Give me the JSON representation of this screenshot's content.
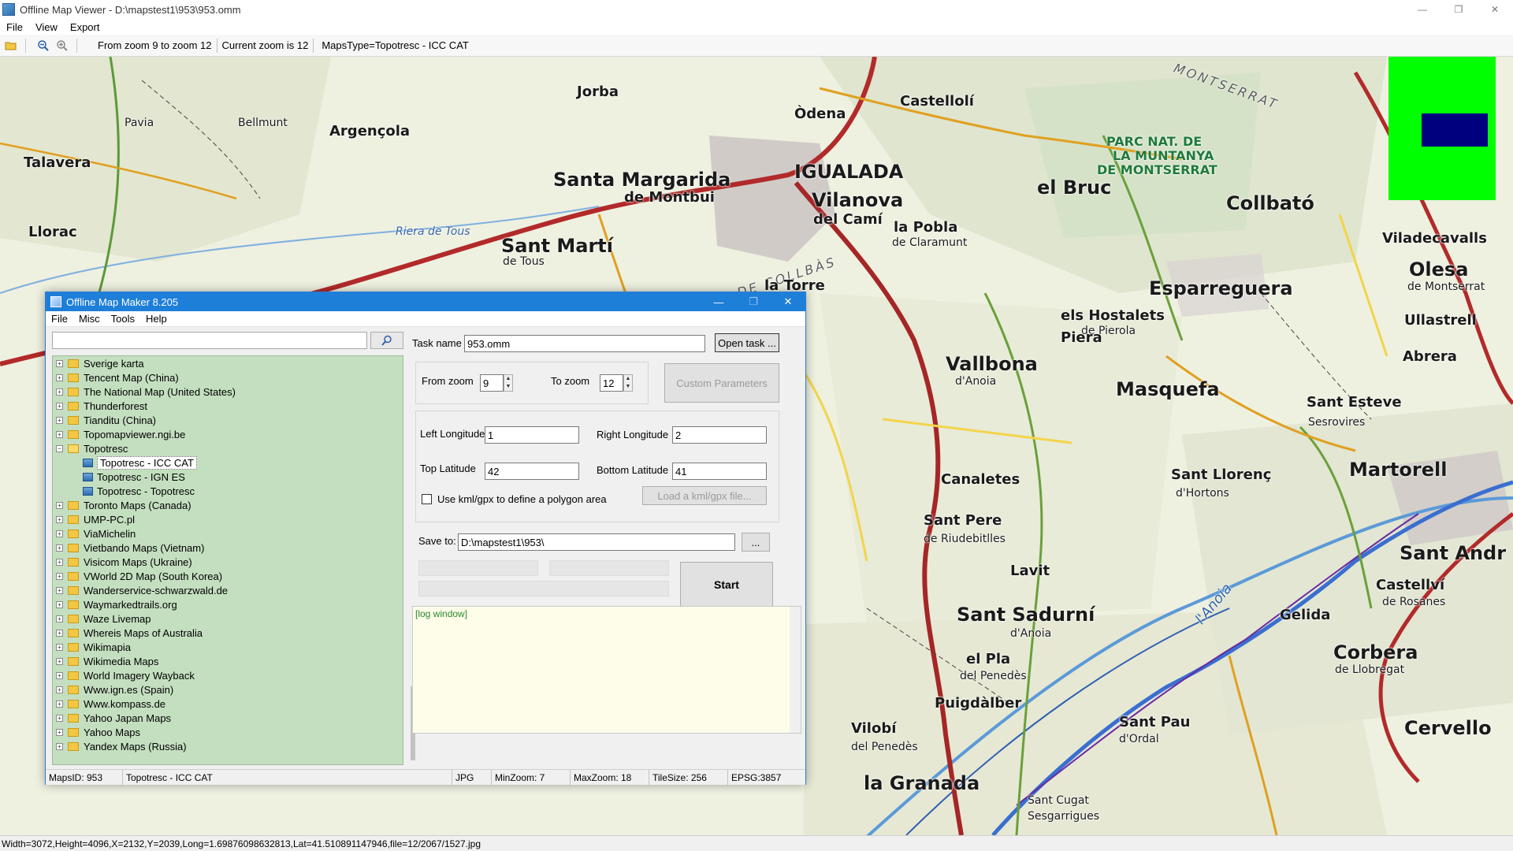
{
  "window": {
    "title": "Offline Map Viewer - D:\\mapstest1\\953\\953.omm",
    "minimize": "—",
    "maximize": "❐",
    "close": "✕"
  },
  "menu": [
    "File",
    "View",
    "Export"
  ],
  "toolbar": {
    "zoom_range": "From zoom 9 to zoom 12",
    "current_zoom": "Current zoom is 12",
    "maps_type": "MapsType=Topotresc - ICC CAT"
  },
  "map": {
    "labels": {
      "igualada": "IGUALADA",
      "vilanova": "Vilanova",
      "del_cami": "del Camí",
      "odena": "Òdena",
      "castellolli": "Castellolí",
      "santa_margarida": "Santa Margarida",
      "de_montbui": "de Montbui",
      "sant_marti": "Sant Martí",
      "de_tous": "de Tous",
      "la_pobla": "la Pobla",
      "de_claramunt": "de Claramunt",
      "el_bruc": "el Bruc",
      "collbato": "Collbató",
      "esparreguera": "Esparreguera",
      "olesa": "Olesa",
      "de_montserrat": "de Montserrat",
      "ullastrell": "Ullastrell",
      "abrera": "Abrera",
      "els_hostalets": "els Hostalets",
      "de_pierola": "de Pierola",
      "masquefa": "Masquefa",
      "vallbona": "Vallbona",
      "d_anoia": "d'Anoia",
      "sant_esteve": "Sant Esteve",
      "sesrovires": "Sesrovires",
      "martorell": "Martorell",
      "sant_llorenc": "Sant Llorenç",
      "d_hortons": "d'Hortons",
      "sant_pere": "Sant Pere",
      "de_riudebitlles": "de Riudebitlles",
      "lavit": "Lavit",
      "sant_sadurni": "Sant Sadurní",
      "d_anoia2": "d'Anoia",
      "gelida": "Gelida",
      "corbera": "Corbera",
      "de_llobregat": "de Llobregat",
      "sant_andreu": "Sant Andr",
      "sant_pau": "Sant Pau",
      "d_ordal": "d'Ordal",
      "vilobi": "Vilobí",
      "del_penedes": "del Penedès",
      "la_granada": "la Granada",
      "sant_cugat": "Sant Cugat",
      "sesgarrigues": "Sesgarrigues",
      "talavera": "Talavera",
      "llorac": "Llorac",
      "argencola": "Argençola",
      "viladecavalls": "Viladecavalls",
      "parc_nat": "PARC NAT. DE",
      "la_muntanya": "LA MUNTANYA",
      "de_montserrat_park": "DE MONTSERRAT",
      "montserrat_range": "MONTSERRAT",
      "serra_de_collbas": "SERRA DE COLLBÀS",
      "riera_de_tous": "Riera de Tous",
      "l_anoia": "l'Anoia",
      "puigdalber": "Puigdàlber",
      "el_pla": "el Pla",
      "del_penedes2": "del Penedès",
      "cervello": "Cervello",
      "la_torre": "la Torre",
      "canaletes": "Canaletes",
      "pavia": "Pavia",
      "bellmunt": "Bellmunt",
      "jorba": "Jorba",
      "piera": "Piera",
      "castellvi": "Castellví",
      "de_rosanes": "de Rosanes"
    }
  },
  "status_bar": "Width=3072,Height=4096,X=2132,Y=2039,Long=1.69876098632813,Lat=41.510891147946,file=12/2067/1527.jpg",
  "dialog": {
    "title": "Offline Map Maker 8.205",
    "menu": [
      "File",
      "Misc",
      "Tools",
      "Help"
    ],
    "search_placeholder": "",
    "tree": [
      {
        "label": "Sverige karta",
        "expanded": false
      },
      {
        "label": "Tencent Map (China)",
        "expanded": false
      },
      {
        "label": "The National Map (United States)",
        "expanded": false
      },
      {
        "label": "Thunderforest",
        "expanded": false
      },
      {
        "label": "Tianditu (China)",
        "expanded": false
      },
      {
        "label": "Topomapviewer.ngi.be",
        "expanded": false
      },
      {
        "label": "Topotresc",
        "expanded": true
      },
      {
        "label": "Topotresc - ICC CAT",
        "child": true,
        "selected": true
      },
      {
        "label": "Topotresc - IGN ES",
        "child": true
      },
      {
        "label": "Topotresc - Topotresc",
        "child": true
      },
      {
        "label": "Toronto Maps (Canada)",
        "expanded": false
      },
      {
        "label": "UMP-PC.pl",
        "expanded": false
      },
      {
        "label": "ViaMichelin",
        "expanded": false
      },
      {
        "label": "Vietbando Maps (Vietnam)",
        "expanded": false
      },
      {
        "label": "Visicom Maps (Ukraine)",
        "expanded": false
      },
      {
        "label": "VWorld 2D Map (South Korea)",
        "expanded": false
      },
      {
        "label": "Wanderservice-schwarzwald.de",
        "expanded": false
      },
      {
        "label": "Waymarkedtrails.org",
        "expanded": false
      },
      {
        "label": "Waze Livemap",
        "expanded": false
      },
      {
        "label": "Whereis Maps of Australia",
        "expanded": false
      },
      {
        "label": "Wikimapia",
        "expanded": false
      },
      {
        "label": "Wikimedia Maps",
        "expanded": false
      },
      {
        "label": "World Imagery Wayback",
        "expanded": false
      },
      {
        "label": "Www.ign.es (Spain)",
        "expanded": false
      },
      {
        "label": "Www.kompass.de",
        "expanded": false
      },
      {
        "label": "Yahoo Japan Maps",
        "expanded": false
      },
      {
        "label": "Yahoo Maps",
        "expanded": false
      },
      {
        "label": "Yandex Maps (Russia)",
        "expanded": false
      }
    ],
    "task_name_label": "Task name",
    "task_name_value": "953.omm",
    "open_task": "Open task ...",
    "from_zoom_label": "From zoom",
    "from_zoom_value": "9",
    "to_zoom_label": "To zoom",
    "to_zoom_value": "12",
    "custom_parameters": "Custom Parameters",
    "left_longitude_label": "Left Longitude",
    "left_longitude_value": "1",
    "right_longitude_label": "Right Longitude",
    "right_longitude_value": "2",
    "top_latitude_label": "Top Latitude",
    "top_latitude_value": "42",
    "bottom_latitude_label": "Bottom Latitude",
    "bottom_latitude_value": "41",
    "kml_checkbox_label": "Use kml/gpx to define a polygon area",
    "load_kml": "Load a kml/gpx file...",
    "save_to_label": "Save to:",
    "save_to_value": "D:\\mapstest1\\953\\",
    "browse": "...",
    "start": "Start",
    "log": "[log window]",
    "status": {
      "maps_id": "MapsID: 953",
      "map_name": "Topotresc - ICC CAT",
      "format": "JPG",
      "min_zoom": "MinZoom: 7",
      "max_zoom": "MaxZoom: 18",
      "tile_size": "TileSize: 256",
      "epsg": "EPSG:3857"
    }
  }
}
